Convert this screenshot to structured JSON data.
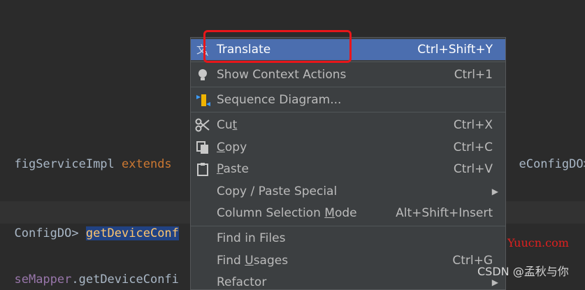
{
  "code": {
    "line1": {
      "a": "figServiceImpl ",
      "b": "extends",
      "c": "eConfigDO>"
    },
    "line2": {
      "a": "ConfigDO> ",
      "sel": "getDeviceConf"
    },
    "line3": {
      "a": "seMapper",
      "b": ".getDeviceConfi"
    }
  },
  "menu": {
    "translate": {
      "label": "Translate",
      "shortcut": "Ctrl+Shift+Y",
      "icon": "translate-icon"
    },
    "context": {
      "label": "Show Context Actions",
      "shortcut": "Ctrl+1",
      "icon": "lightbulb-icon"
    },
    "sequence": {
      "label": "Sequence Diagram...",
      "icon": "sequence-diagram-icon"
    },
    "cut": {
      "pre": "Cu",
      "u": "t",
      "post": "",
      "shortcut": "Ctrl+X",
      "icon": "scissors-icon"
    },
    "copy": {
      "pre": "",
      "u": "C",
      "post": "opy",
      "shortcut": "Ctrl+C",
      "icon": "copy-icon"
    },
    "paste": {
      "pre": "",
      "u": "P",
      "post": "aste",
      "shortcut": "Ctrl+V",
      "icon": "clipboard-icon"
    },
    "copy_paste_special": {
      "label": "Copy / Paste Special",
      "icon": "chevron-right-icon"
    },
    "column_mode": {
      "pre": "Column Selection ",
      "u": "M",
      "post": "ode",
      "shortcut": "Alt+Shift+Insert"
    },
    "find_files": {
      "label": "Find in Files"
    },
    "find_usages": {
      "pre": "Find ",
      "u": "U",
      "post": "sages",
      "shortcut": "Ctrl+G"
    },
    "refactor": {
      "label": "Refactor"
    }
  },
  "watermark": {
    "site": "Yuucn.com",
    "author": "CSDN @孟秋与你"
  },
  "colors": {
    "highlight_box": "#e8161a",
    "menu_bg": "#3c3f41",
    "active_item": "#4b6eaf",
    "editor_bg": "#2b2b2b"
  }
}
